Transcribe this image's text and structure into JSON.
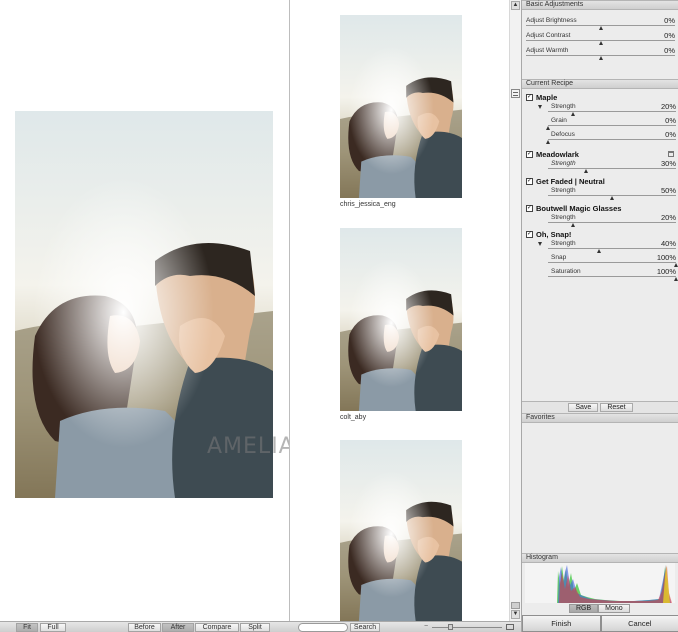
{
  "toolbar": {
    "fit": "Fit",
    "full": "Full",
    "before": "Before",
    "after": "After",
    "compare": "Compare",
    "split": "Split",
    "search": "Search"
  },
  "watermark": "AMELIA LYON",
  "thumbnails": [
    {
      "label": "chris_jessica_eng"
    },
    {
      "label": "colt_aby"
    },
    {
      "label": ""
    }
  ],
  "basic": {
    "header": "Basic Adjustments",
    "rows": [
      {
        "label": "Adjust Brightness",
        "value": "0%",
        "level": 0
      },
      {
        "label": "Adjust Contrast",
        "value": "0%",
        "level": 0
      },
      {
        "label": "Adjust Warmth",
        "value": "0%",
        "level": 0
      }
    ]
  },
  "recipe": {
    "header": "Current Recipe",
    "maple": {
      "title": "Maple",
      "strength_label": "Strength",
      "strength_value": "20%",
      "strength_level": 20,
      "grain_label": "Grain",
      "grain_value": "0%",
      "grain_level": 0,
      "defocus_label": "Defocus",
      "defocus_value": "0%",
      "defocus_level": 0
    },
    "meadowlark": {
      "title": "Meadowlark",
      "strength_label": "Strength",
      "strength_value": "30%",
      "strength_level": 30
    },
    "faded": {
      "title": "Get Faded | Neutral",
      "strength_label": "Strength",
      "strength_value": "50%",
      "strength_level": 50
    },
    "magic": {
      "title": "Boutwell Magic Glasses",
      "strength_label": "Strength",
      "strength_value": "20%",
      "strength_level": 20
    },
    "snap": {
      "title": "Oh, Snap!",
      "strength_label": "Strength",
      "strength_value": "40%",
      "strength_level": 40,
      "snap_label": "Snap",
      "snap_value": "100%",
      "snap_level": 100,
      "saturation_label": "Saturation",
      "saturation_value": "100%",
      "saturation_level": 100
    },
    "save": "Save",
    "reset": "Reset"
  },
  "favorites": {
    "header": "Favorites"
  },
  "histogram": {
    "header": "Histogram",
    "rgb": "RGB",
    "mono": "Mono"
  },
  "actions": {
    "finish": "Finish",
    "cancel": "Cancel"
  }
}
